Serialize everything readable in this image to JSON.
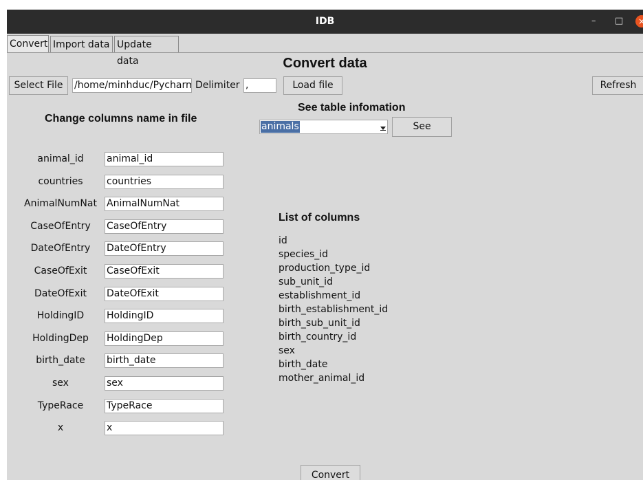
{
  "window": {
    "title": "IDB",
    "minimize": "–",
    "maximize": "□",
    "close": "×"
  },
  "tabs": [
    {
      "label": "Convert",
      "active": true
    },
    {
      "label": "Import data",
      "active": false
    },
    {
      "label": "Update data",
      "active": false
    }
  ],
  "page_title": "Convert data",
  "toolbar": {
    "select_file_label": "Select File",
    "file_path": "/home/minhduc/Pycharm",
    "delimiter_label": "Delimiter",
    "delimiter_value": ",",
    "load_file_label": "Load file",
    "refresh_label": "Refresh"
  },
  "rename_section": {
    "heading": "Change columns name in file",
    "rows": [
      {
        "label": "animal_id",
        "value": "animal_id"
      },
      {
        "label": "countries",
        "value": "countries"
      },
      {
        "label": "AnimalNumNat",
        "value": "AnimalNumNat"
      },
      {
        "label": "CaseOfEntry",
        "value": "CaseOfEntry"
      },
      {
        "label": "DateOfEntry",
        "value": "DateOfEntry"
      },
      {
        "label": "CaseOfExit",
        "value": "CaseOfExit"
      },
      {
        "label": "DateOfExit",
        "value": "DateOfExit"
      },
      {
        "label": "HoldingID",
        "value": "HoldingID"
      },
      {
        "label": "HoldingDep",
        "value": "HoldingDep"
      },
      {
        "label": "birth_date",
        "value": "birth_date"
      },
      {
        "label": "sex",
        "value": "sex"
      },
      {
        "label": "TypeRace",
        "value": "TypeRace"
      },
      {
        "label": "x",
        "value": "x"
      }
    ]
  },
  "table_info": {
    "heading": "See table infomation",
    "selected_table": "animals",
    "see_label": "See",
    "columns_heading": "List of columns",
    "columns": [
      "id",
      "species_id",
      "production_type_id",
      "sub_unit_id",
      "establishment_id",
      "birth_establishment_id",
      "birth_sub_unit_id",
      "birth_country_id",
      "sex",
      "birth_date",
      "mother_animal_id"
    ]
  },
  "convert_label": "Convert"
}
